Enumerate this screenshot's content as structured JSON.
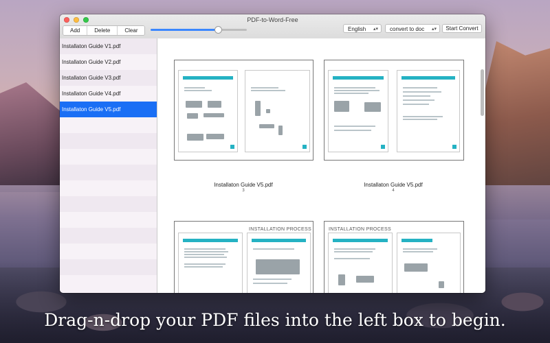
{
  "window": {
    "title": "PDF-to-Word-Free"
  },
  "toolbar": {
    "add_label": "Add",
    "delete_label": "Delete",
    "clear_label": "Clear",
    "zoom_level": 0.7,
    "language": "English",
    "format": "convert to doc",
    "start_label": "Start Convert"
  },
  "sidebar": {
    "items": [
      {
        "label": "Installaton Guide V1.pdf",
        "selected": false
      },
      {
        "label": "Installaton Guide V2.pdf",
        "selected": false
      },
      {
        "label": "Installaton Guide V3.pdf",
        "selected": false
      },
      {
        "label": "Installaton Guide V4.pdf",
        "selected": false
      },
      {
        "label": "Installaton Guide V5.pdf",
        "selected": true
      }
    ]
  },
  "pages": [
    {
      "label": "Installaton Guide V5.pdf",
      "number": "3"
    },
    {
      "label": "Installaton Guide V5.pdf",
      "number": "4"
    },
    {
      "heading": "INSTALLATION PROCESS"
    },
    {
      "heading": "INSTALLATION PROCESS"
    }
  ],
  "caption": "Drag-n-drop your PDF files into the left box to begin.",
  "colors": {
    "accent": "#1a6ff5",
    "doc_accent": "#25b2c3"
  }
}
